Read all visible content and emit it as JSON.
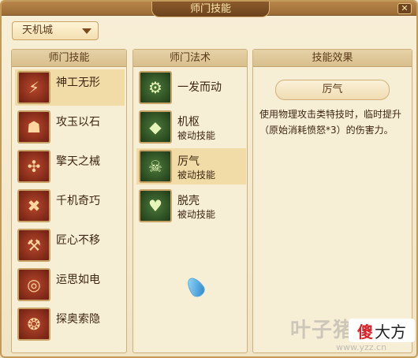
{
  "window": {
    "title": "师门技能",
    "close_label": "✕"
  },
  "school_dropdown": {
    "selected": "天机城"
  },
  "skills_panel": {
    "header": "师门技能",
    "items": [
      {
        "name": "神工无形",
        "icon": "lightning-swirl-icon",
        "selected": true
      },
      {
        "name": "攻玉以石",
        "icon": "stone-mask-icon",
        "selected": false
      },
      {
        "name": "擎天之械",
        "icon": "windmill-icon",
        "selected": false
      },
      {
        "name": "千机奇巧",
        "icon": "crossed-hammers-icon",
        "selected": false
      },
      {
        "name": "匠心不移",
        "icon": "anvil-hammer-icon",
        "selected": false
      },
      {
        "name": "运思如电",
        "icon": "eyes-swirl-icon",
        "selected": false
      },
      {
        "name": "探奥索隐",
        "icon": "vortex-icon",
        "selected": false
      }
    ]
  },
  "arts_panel": {
    "header": "师门法术",
    "items": [
      {
        "name": "一发而动",
        "sub": "",
        "icon": "gears-icon",
        "selected": false
      },
      {
        "name": "机枢",
        "sub": "被动技能",
        "icon": "crystal-shield-icon",
        "selected": false
      },
      {
        "name": "厉气",
        "sub": "被动技能",
        "icon": "demon-face-icon",
        "selected": true
      },
      {
        "name": "脱壳",
        "sub": "被动技能",
        "icon": "heart-shell-icon",
        "selected": false
      }
    ]
  },
  "effect_panel": {
    "header": "技能效果",
    "skill_name": "厉气",
    "description": "使用物理攻击类特技时，临时提升（原始消耗愤怒*3）的伤害力。"
  },
  "watermark": {
    "text": "叶子猪",
    "url": "www.yzz.cn",
    "logo_text_red": "傻",
    "logo_text": "大方"
  },
  "colors": {
    "frame": "#c29a5a",
    "selected_row": "#f1dca7",
    "text": "#3c2612"
  }
}
